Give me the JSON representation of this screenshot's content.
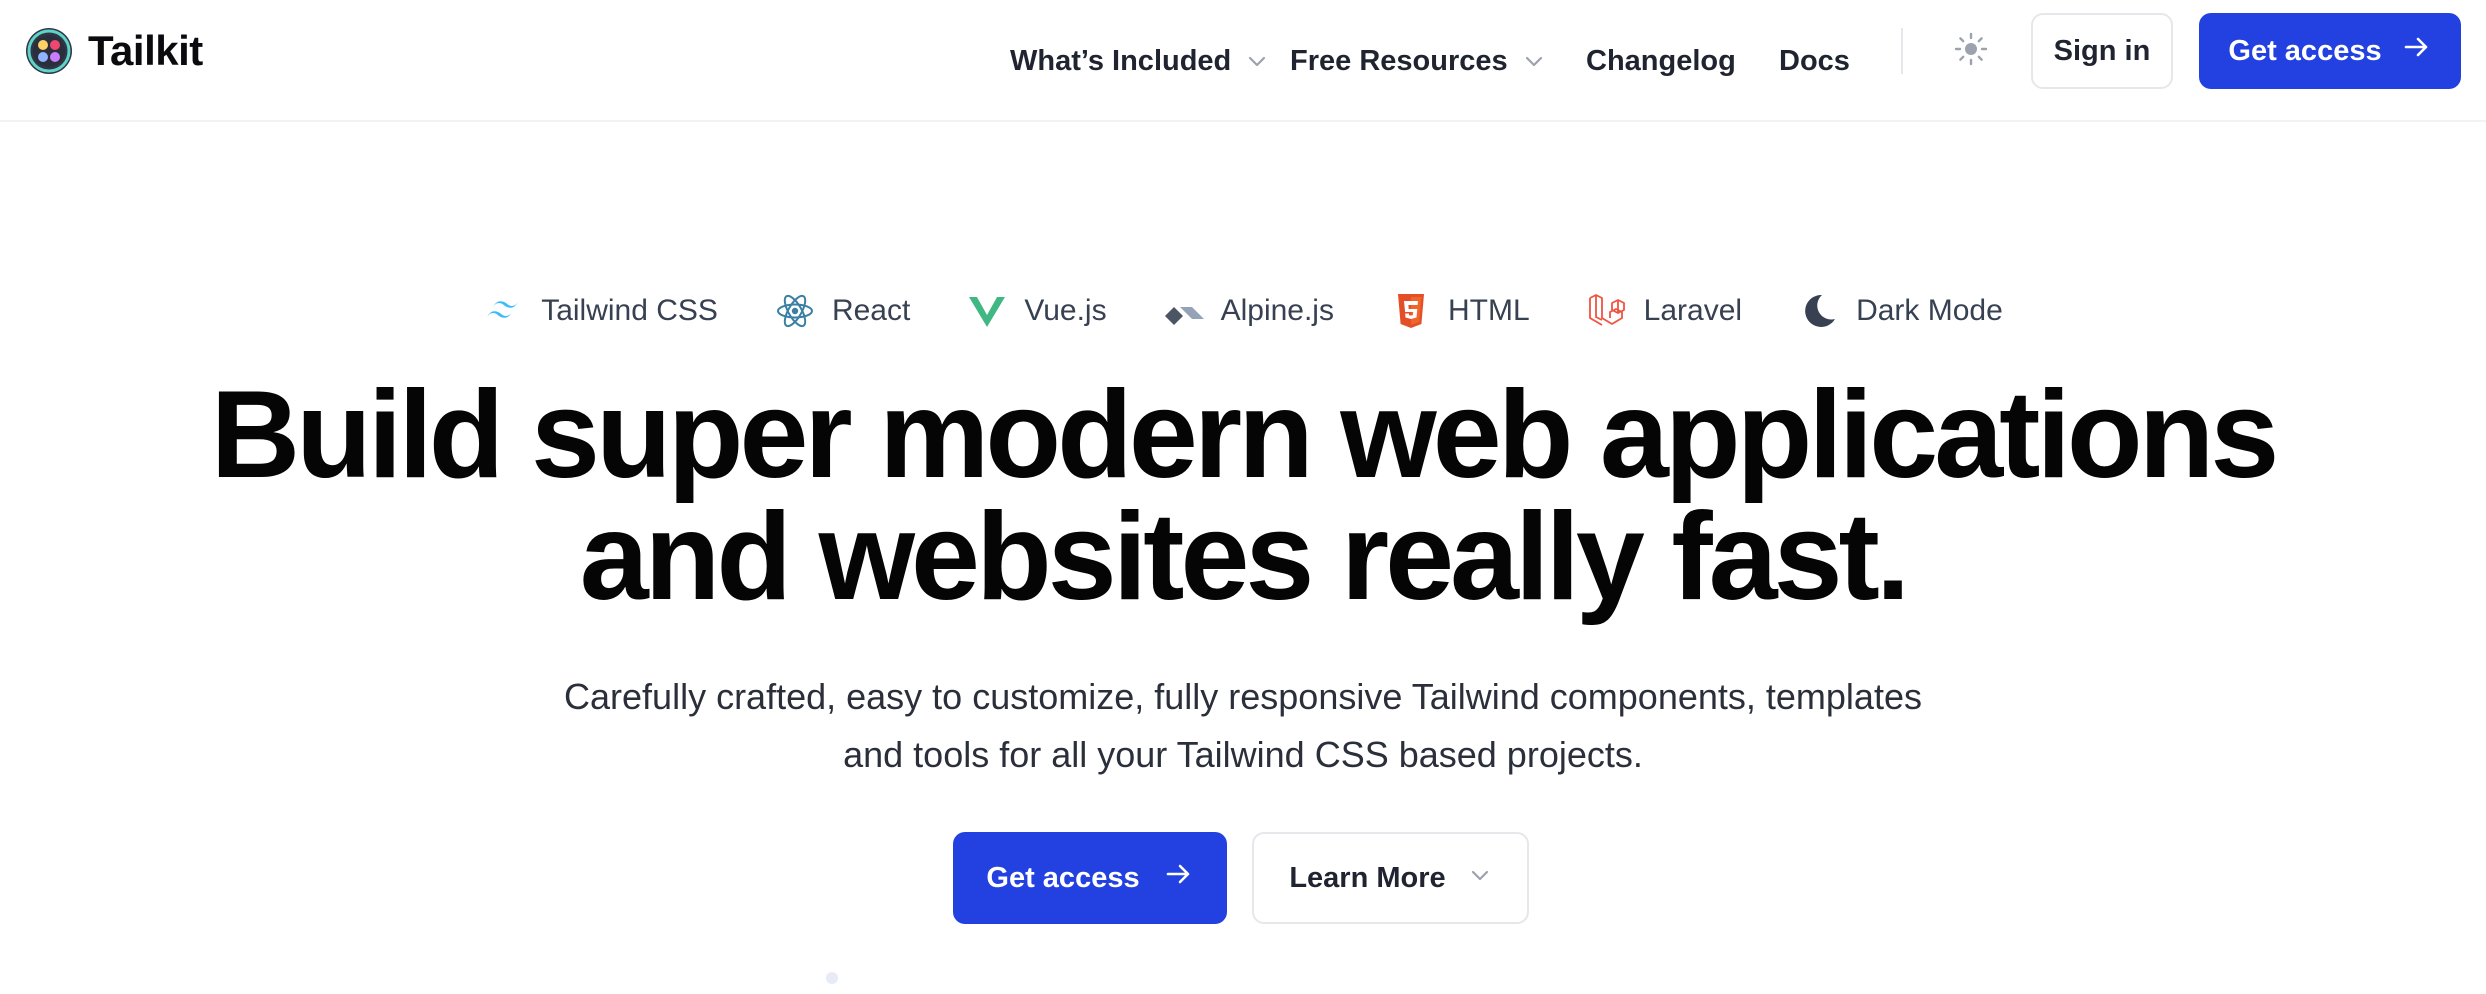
{
  "brand": {
    "name": "Tailkit",
    "icon": "tailkit-logo-icon"
  },
  "nav": {
    "items": [
      {
        "label": "What’s Included",
        "icon": "chevron-down-icon"
      },
      {
        "label": "Free Resources",
        "icon": "chevron-down-icon"
      },
      {
        "label": "Changelog"
      },
      {
        "label": "Docs"
      }
    ],
    "theme_toggle_icon": "sun-icon",
    "sign_in_label": "Sign in",
    "cta_label": "Get access",
    "cta_icon": "arrow-right-icon"
  },
  "tech": [
    {
      "label": "Tailwind CSS",
      "icon": "tailwind-icon"
    },
    {
      "label": "React",
      "icon": "react-icon"
    },
    {
      "label": "Vue.js",
      "icon": "vue-icon"
    },
    {
      "label": "Alpine.js",
      "icon": "alpine-icon"
    },
    {
      "label": "HTML",
      "icon": "html5-icon"
    },
    {
      "label": "Laravel",
      "icon": "laravel-icon"
    },
    {
      "label": "Dark Mode",
      "icon": "moon-icon"
    }
  ],
  "hero": {
    "title_line1": "Build super modern web applications",
    "title_line2": "and websites really fast.",
    "subtitle_line1": "Carefully crafted, easy to customize, fully responsive Tailwind components, templates",
    "subtitle_line2": "and tools for all your Tailwind CSS based projects.",
    "primary_cta": "Get access",
    "secondary_cta": "Learn More"
  },
  "colors": {
    "accent": "#2341e0",
    "text": "#1f2430",
    "border": "#e5e7eb"
  }
}
